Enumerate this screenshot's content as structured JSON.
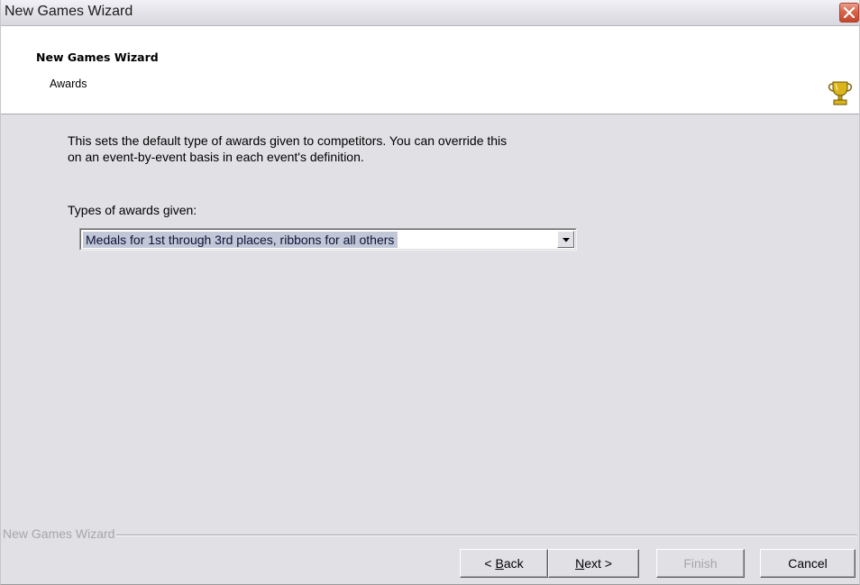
{
  "window": {
    "title": "New Games Wizard"
  },
  "header": {
    "title": "New Games Wizard",
    "subtitle": "Awards",
    "icon": "trophy-icon"
  },
  "body": {
    "description_line1": "This sets the default type of awards given to competitors. You can override this",
    "description_line2": "on an event-by-event basis in each event's definition.",
    "awards_label": "Types of awards given:",
    "awards_selected": "Medals for 1st through 3rd places, ribbons for all others"
  },
  "footer": {
    "group_label": "New Games Wizard",
    "back_prefix": "< ",
    "back_mnemonic": "B",
    "back_rest": "ack",
    "next_mnemonic": "N",
    "next_rest": "ext >",
    "finish_label": "Finish",
    "cancel_label": "Cancel"
  },
  "colors": {
    "window_bg": "#e1e0e5",
    "header_bg": "#ffffff",
    "selection_bg": "#c2c7d8",
    "disabled_text": "#a6a6ab",
    "close_button": "#d8654a",
    "trophy_gold": "#d9b41a"
  }
}
